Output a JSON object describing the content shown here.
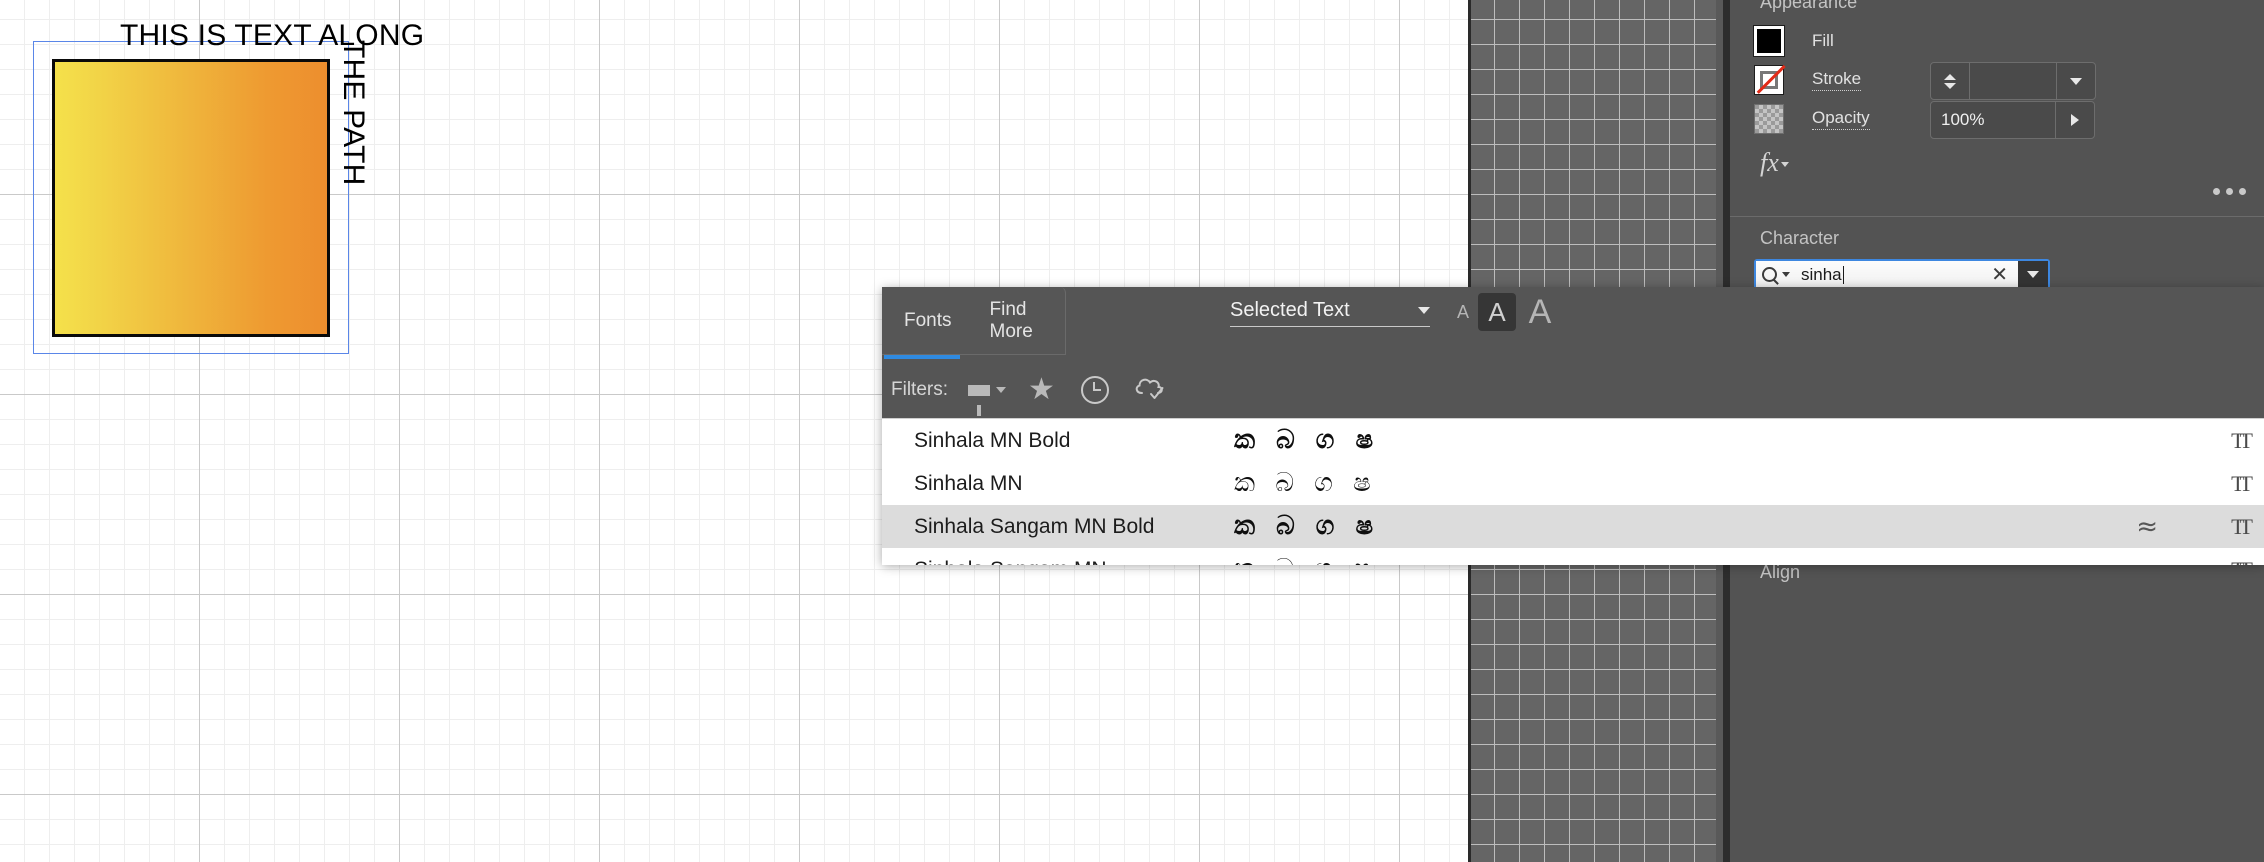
{
  "canvas": {
    "artwork_text_line1": "THIS IS TEXT ALONG",
    "artwork_text_line2": "THE PATH",
    "gradient_start": "#F5E14B",
    "gradient_end": "#ED8E2E",
    "selection_color": "#5A86E8"
  },
  "appearance": {
    "title": "Appearance",
    "fill_label": "Fill",
    "stroke_label": "Stroke",
    "stroke_value": "",
    "opacity_label": "Opacity",
    "opacity_value": "100%",
    "fx_label": "fx",
    "more_label": "•••"
  },
  "character": {
    "title": "Character",
    "search_value": "sinha",
    "clear_label": "✕"
  },
  "align": {
    "title": "Align"
  },
  "fonts_panel": {
    "tabs": [
      {
        "label": "Fonts",
        "active": true
      },
      {
        "label": "Find More",
        "active": false
      }
    ],
    "filters_label": "Filters:",
    "filter_icons": [
      "funnel-icon",
      "star-icon",
      "clock-icon",
      "cloud-check-icon"
    ],
    "scope_dropdown": "Selected Text",
    "size_buttons": [
      "A",
      "A",
      "A"
    ],
    "size_selected_index": 1,
    "rows": [
      {
        "name": "Sinhala MN Bold",
        "preview": "ක බ ග ෂ",
        "bold": true,
        "selected": false,
        "has_variable_icon": false,
        "format_icon": "TT"
      },
      {
        "name": "Sinhala MN",
        "preview": "ක බ ග ෂ",
        "bold": false,
        "selected": false,
        "has_variable_icon": false,
        "format_icon": "TT"
      },
      {
        "name": "Sinhala Sangam MN Bold",
        "preview": "ක බ ග ෂ",
        "bold": true,
        "selected": true,
        "has_variable_icon": true,
        "variable_icon": "≈",
        "format_icon": "TT"
      },
      {
        "name": "Sinhala Sangam MN",
        "preview": "ක බ ග ෂ",
        "bold": false,
        "selected": false,
        "has_variable_icon": false,
        "format_icon": "TT"
      }
    ]
  }
}
